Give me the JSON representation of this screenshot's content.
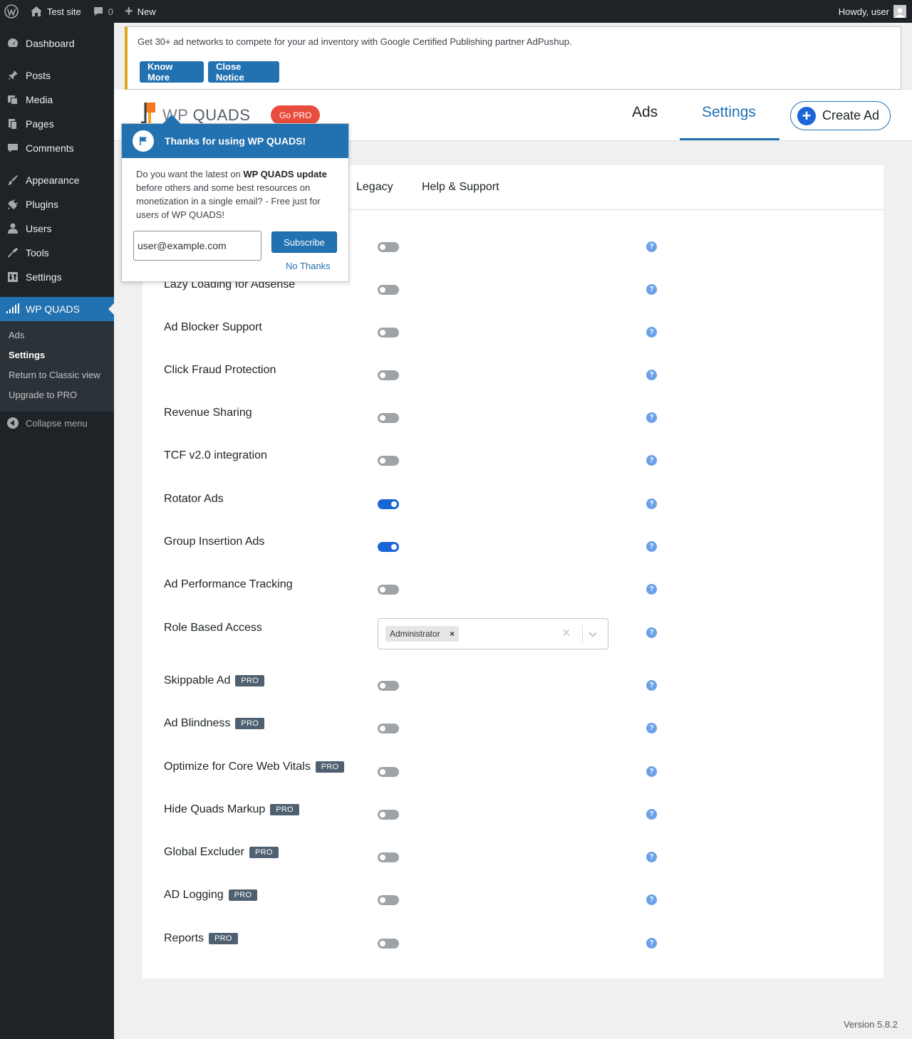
{
  "adminbar": {
    "site_name": "Test site",
    "comments_count": "0",
    "new_label": "New",
    "howdy": "Howdy, user"
  },
  "sidebar": {
    "items": [
      {
        "label": "Dashboard",
        "icon": "dashboard-icon"
      },
      {
        "label": "Posts",
        "icon": "pin-icon"
      },
      {
        "label": "Media",
        "icon": "media-icon"
      },
      {
        "label": "Pages",
        "icon": "pages-icon"
      },
      {
        "label": "Comments",
        "icon": "comment-icon"
      },
      {
        "label": "Appearance",
        "icon": "brush-icon"
      },
      {
        "label": "Plugins",
        "icon": "plug-icon"
      },
      {
        "label": "Users",
        "icon": "user-icon"
      },
      {
        "label": "Tools",
        "icon": "wrench-icon"
      },
      {
        "label": "Settings",
        "icon": "settings-icon"
      },
      {
        "label": "WP QUADS",
        "icon": "signal-icon"
      }
    ],
    "submenu": [
      "Ads",
      "Settings",
      "Return to Classic view",
      "Upgrade to PRO"
    ],
    "collapse": "Collapse menu"
  },
  "notice": {
    "text": "Get 30+ ad networks to compete for your ad inventory with Google Certified Publishing partner AdPushup.",
    "know_more": "Know More",
    "close": "Close Notice"
  },
  "header": {
    "logo_wp": "WP",
    "logo_quads": "QUADS",
    "go_pro": "Go PRO",
    "tab_ads": "Ads",
    "tab_settings": "Settings",
    "create_ad": "Create Ad"
  },
  "subtabs": [
    "Legacy",
    "Help & Support"
  ],
  "settings_rows": [
    {
      "label": "",
      "on": false,
      "pro": false
    },
    {
      "label": "Lazy Loading for Adsense",
      "on": false,
      "pro": false
    },
    {
      "label": "Ad Blocker Support",
      "on": false,
      "pro": false
    },
    {
      "label": "Click Fraud Protection",
      "on": false,
      "pro": false
    },
    {
      "label": "Revenue Sharing",
      "on": false,
      "pro": false
    },
    {
      "label": "TCF v2.0 integration",
      "on": false,
      "pro": false
    },
    {
      "label": "Rotator Ads",
      "on": true,
      "pro": false
    },
    {
      "label": "Group Insertion Ads",
      "on": true,
      "pro": false
    },
    {
      "label": "Ad Performance Tracking",
      "on": false,
      "pro": false
    },
    {
      "label": "Role Based Access",
      "select": true
    },
    {
      "label": "Skippable Ad",
      "on": false,
      "pro": true
    },
    {
      "label": "Ad Blindness",
      "on": false,
      "pro": true
    },
    {
      "label": "Optimize for Core Web Vitals",
      "on": false,
      "pro": true
    },
    {
      "label": "Hide Quads Markup",
      "on": false,
      "pro": true
    },
    {
      "label": "Global Excluder",
      "on": false,
      "pro": true
    },
    {
      "label": "AD Logging",
      "on": false,
      "pro": true
    },
    {
      "label": "Reports",
      "on": false,
      "pro": true
    }
  ],
  "pro_label": "PRO",
  "role_select": {
    "selected": "Administrator"
  },
  "popup": {
    "title": "Thanks for using WP QUADS!",
    "body_pre": "Do you want the latest on ",
    "body_bold": "WP QUADS update",
    "body_post": " before others and some best resources on monetization in a single email? - Free just for users of WP QUADS!",
    "email_value": "user@example.com",
    "subscribe": "Subscribe",
    "no_thanks": "No Thanks"
  },
  "version": "Version 5.8.2",
  "colors": {
    "accent": "#2271b1",
    "toggle_on": "#1a66d6",
    "gopro": "#e84c3d",
    "notice_border": "#dba617"
  }
}
